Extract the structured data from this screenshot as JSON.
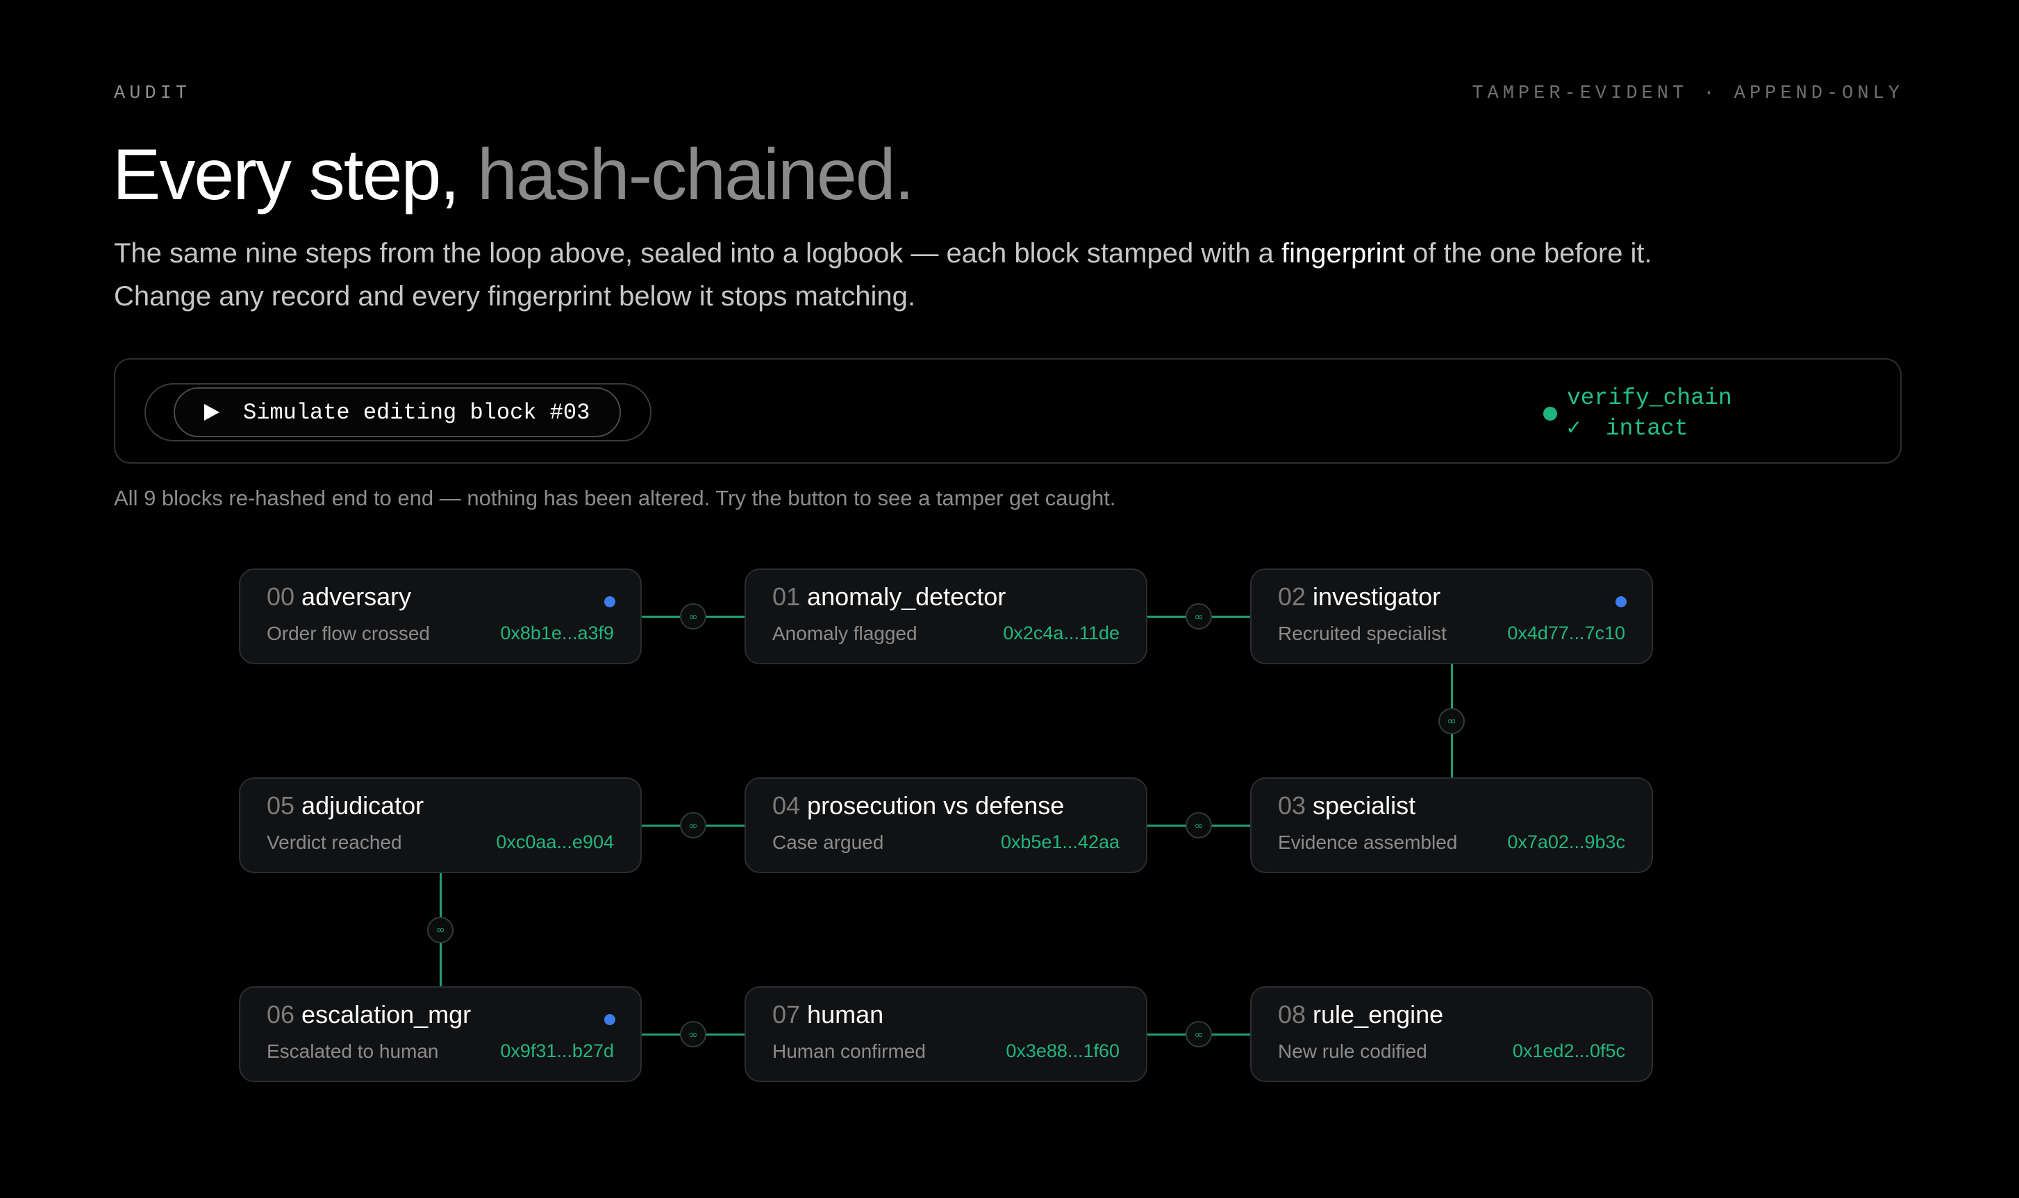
{
  "header": {
    "eyebrow": "AUDIT",
    "eyebrow_right": "TAMPER-EVIDENT · APPEND-ONLY",
    "headline_main": "Every step,",
    "headline_accent": "hash-chained.",
    "lede_before": "The same nine steps from the loop above, sealed into a logbook — each block stamped with a ",
    "lede_highlight": "fingerprint",
    "lede_after": " of the one before it. Change any record and every fingerprint below it stops matching."
  },
  "controls": {
    "simulate_label": "Simulate editing block #03",
    "status_name": "verify_chain",
    "status_check": "✓",
    "status_value": "intact",
    "status_color": "#1fb37f"
  },
  "caption": "All 9 blocks re-hashed end to end — nothing has been altered. Try the button to see a tamper get caught.",
  "colors": {
    "background": "#000000",
    "accent_green": "#22b583",
    "marker_blue": "#3b7dea"
  },
  "blocks": [
    {
      "index": "00",
      "name": "adversary",
      "desc": "Order flow crossed",
      "hash": "0x8b1e...a3f9",
      "marked": true
    },
    {
      "index": "01",
      "name": "anomaly_detector",
      "desc": "Anomaly flagged",
      "hash": "0x2c4a...11de",
      "marked": false
    },
    {
      "index": "02",
      "name": "investigator",
      "desc": "Recruited specialist",
      "hash": "0x4d77...7c10",
      "marked": true
    },
    {
      "index": "03",
      "name": "specialist",
      "desc": "Evidence assembled",
      "hash": "0x7a02...9b3c",
      "marked": false
    },
    {
      "index": "04",
      "name": "prosecution vs defense",
      "desc": "Case argued",
      "hash": "0xb5e1...42aa",
      "marked": false
    },
    {
      "index": "05",
      "name": "adjudicator",
      "desc": "Verdict reached",
      "hash": "0xc0aa...e904",
      "marked": false
    },
    {
      "index": "06",
      "name": "escalation_mgr",
      "desc": "Escalated to human",
      "hash": "0x9f31...b27d",
      "marked": true
    },
    {
      "index": "07",
      "name": "human",
      "desc": "Human confirmed",
      "hash": "0x3e88...1f60",
      "marked": false
    },
    {
      "index": "08",
      "name": "rule_engine",
      "desc": "New rule codified",
      "hash": "0x1ed2...0f5c",
      "marked": false
    }
  ],
  "link_icon": "link-icon"
}
